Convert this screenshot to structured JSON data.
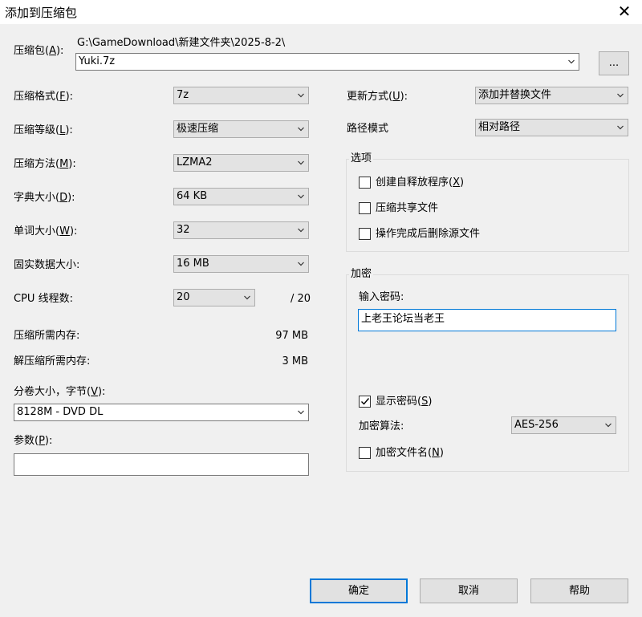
{
  "window": {
    "title": "添加到压缩包",
    "close_glyph": "✕"
  },
  "archive": {
    "label": "压缩包(",
    "label_key": "A",
    "label_tail": "):",
    "path": "G:\\GameDownload\\新建文件夹\\2025-8-2\\",
    "filename": "Yuki.7z",
    "browse_label": "..."
  },
  "left": {
    "format": {
      "label": "压缩格式(",
      "key": "F",
      "tail": "):",
      "value": "7z"
    },
    "level": {
      "label": "压缩等级(",
      "key": "L",
      "tail": "):",
      "value": "极速压缩"
    },
    "method": {
      "label": "压缩方法(",
      "key": "M",
      "tail": "):",
      "value": "LZMA2"
    },
    "dict": {
      "label": "字典大小(",
      "key": "D",
      "tail": "):",
      "value": "64 KB"
    },
    "word": {
      "label": "单词大小(",
      "key": "W",
      "tail": "):",
      "value": "32"
    },
    "solid": {
      "label": "固实数据大小:",
      "value": "16 MB"
    },
    "threads": {
      "label": "CPU 线程数:",
      "value": "20",
      "max": "/ 20"
    },
    "mem_compress": {
      "label": "压缩所需内存:",
      "value": "97 MB"
    },
    "mem_decompress": {
      "label": "解压缩所需内存:",
      "value": "3 MB"
    },
    "volume": {
      "label": "分卷大小，字节(",
      "key": "V",
      "tail": "):",
      "value": "8128M - DVD DL"
    },
    "params": {
      "label": "参数(",
      "key": "P",
      "tail": "):",
      "value": ""
    }
  },
  "right": {
    "update": {
      "label": "更新方式(",
      "key": "U",
      "tail": "):",
      "value": "添加并替换文件"
    },
    "pathmode": {
      "label": "路径模式",
      "value": "相对路径"
    },
    "options": {
      "title": "选项",
      "sfx": {
        "label": "创建自释放程序(",
        "key": "X",
        "tail": ")",
        "checked": false
      },
      "shared": {
        "label": "压缩共享文件",
        "checked": false
      },
      "delete": {
        "label": "操作完成后删除源文件",
        "checked": false
      }
    },
    "encryption": {
      "title": "加密",
      "password_label": "输入密码:",
      "password_value": "上老王论坛当老王",
      "show_password": {
        "label": "显示密码(",
        "key": "S",
        "tail": ")",
        "checked": true
      },
      "method_label": "加密算法:",
      "method_value": "AES-256",
      "encrypt_names": {
        "label": "加密文件名(",
        "key": "N",
        "tail": ")",
        "checked": false
      }
    }
  },
  "buttons": {
    "ok": "确定",
    "cancel": "取消",
    "help": "帮助"
  }
}
